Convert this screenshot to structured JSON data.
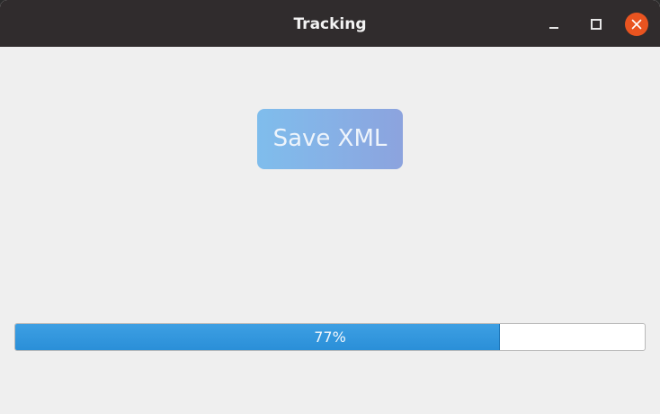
{
  "window": {
    "title": "Tracking",
    "controls": {
      "minimize_icon": "minimize-icon",
      "maximize_icon": "maximize-icon",
      "close_icon": "close-icon"
    }
  },
  "main": {
    "save_button_label": "Save XML",
    "progress": {
      "value": 0.77,
      "label": "77%"
    }
  },
  "colors": {
    "titlebar": "#302c2d",
    "close_button": "#e95420",
    "progress_fill": "#2f93dc",
    "button_gradient_start": "#7fbdec",
    "button_gradient_end": "#8ca3de"
  }
}
